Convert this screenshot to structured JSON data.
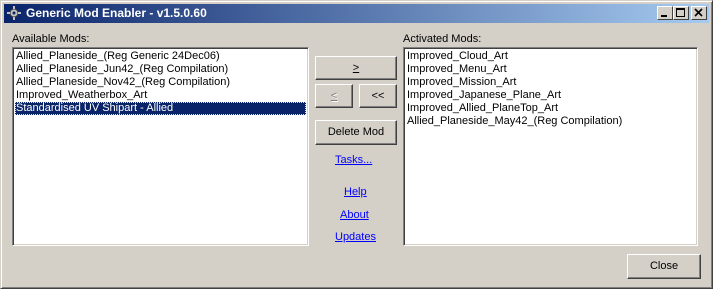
{
  "window": {
    "title": "Generic Mod Enabler - v1.5.0.60"
  },
  "available": {
    "label": "Available Mods:",
    "items": [
      "Allied_Planeside_(Reg Generic 24Dec06)",
      "Allied_Planeside_Jun42_(Reg Compilation)",
      "Allied_Planeside_Nov42_(Reg Compilation)",
      "Improved_Weatherbox_Art",
      "Standardised UV Shipart - Allied"
    ],
    "selected_index": 4
  },
  "activated": {
    "label": "Activated Mods:",
    "items": [
      "Improved_Cloud_Art",
      "Improved_Menu_Art",
      "Improved_Mission_Art",
      "Improved_Japanese_Plane_Art",
      "Improved_Allied_PlaneTop_Art",
      "Allied_Planeside_May42_(Reg Compilation)"
    ]
  },
  "buttons": {
    "activate": ">",
    "deactivate": "<",
    "deactivate_all": "<<",
    "delete_mod": "Delete Mod",
    "close": "Close"
  },
  "links": {
    "tasks": "Tasks...",
    "help": "Help",
    "about": "About",
    "updates": "Updates"
  }
}
